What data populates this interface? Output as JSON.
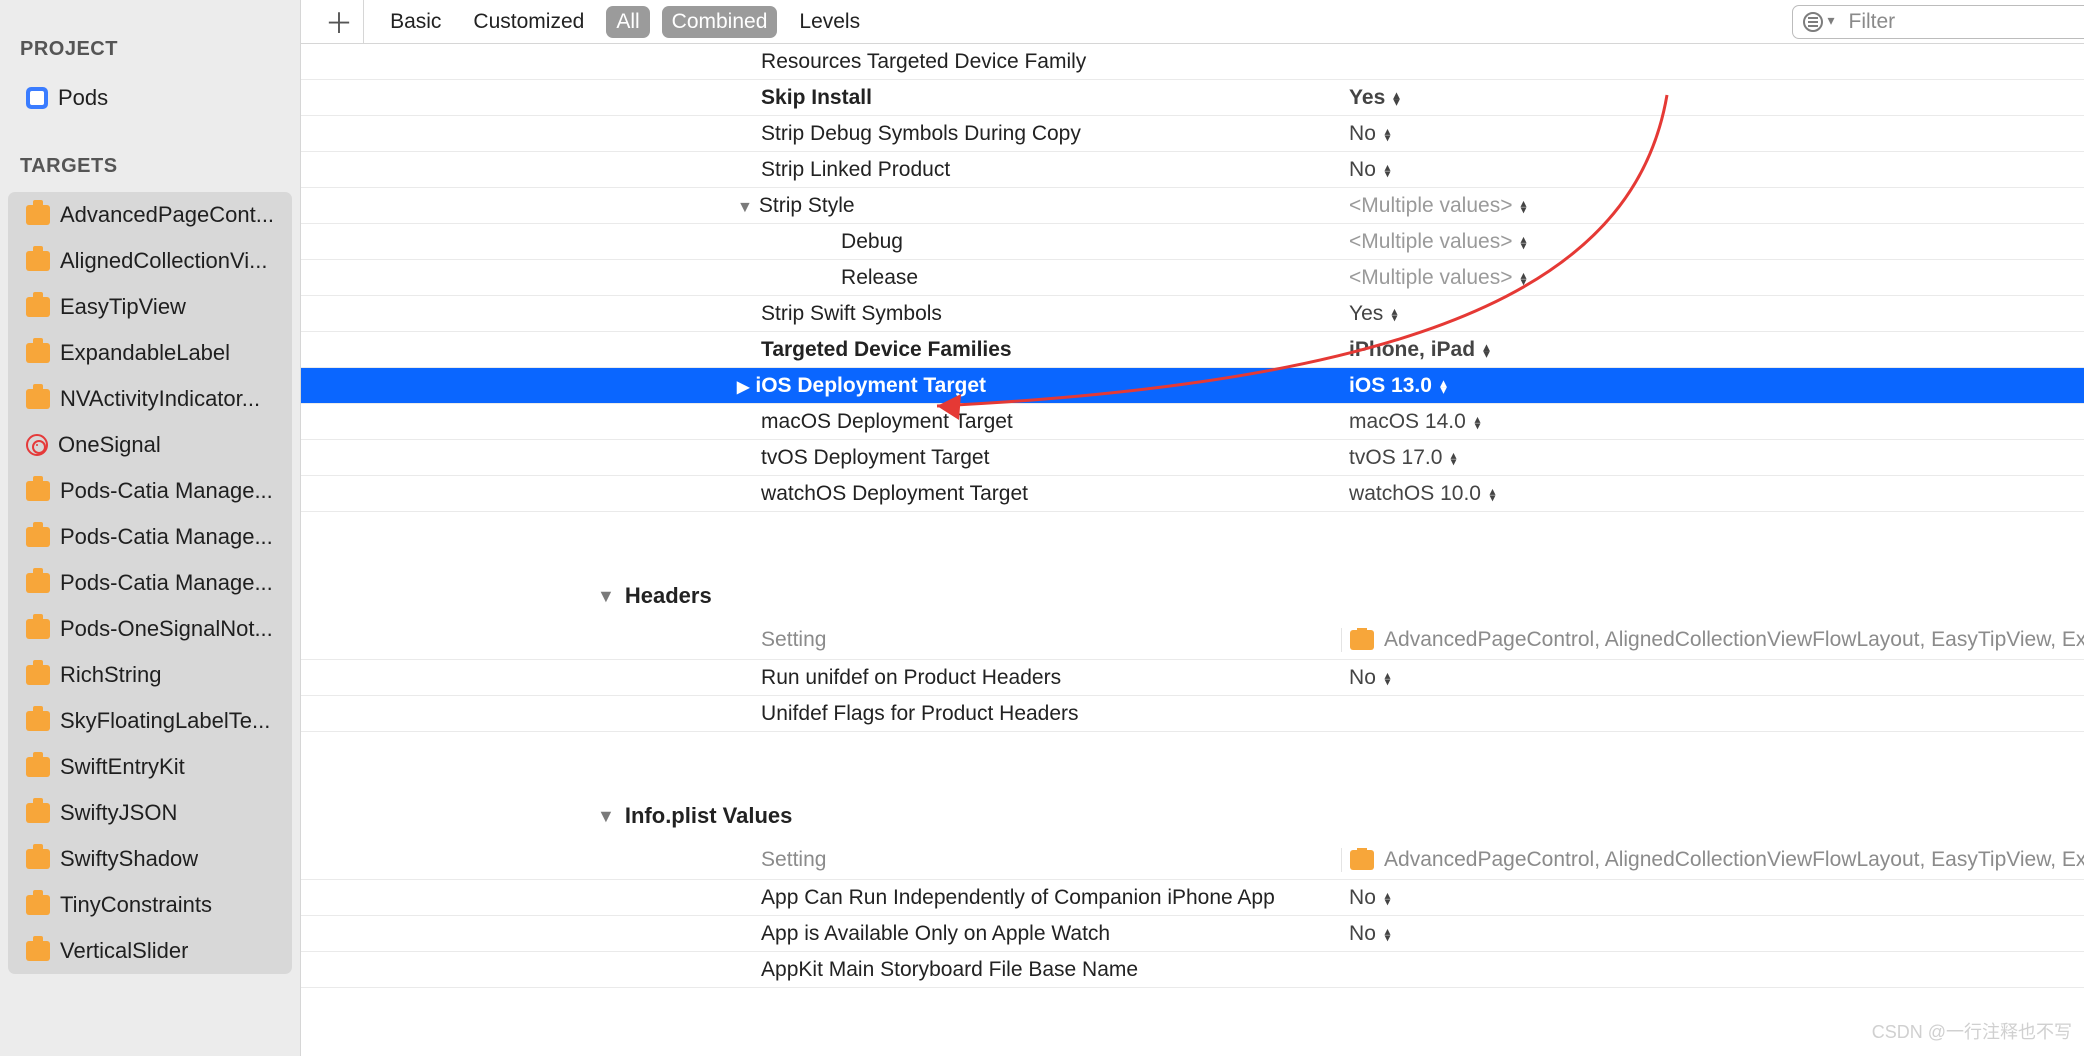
{
  "sidebar": {
    "project_label": "PROJECT",
    "project_name": "Pods",
    "targets_label": "TARGETS",
    "targets": [
      {
        "label": "AdvancedPageCont...",
        "icon": "tool"
      },
      {
        "label": "AlignedCollectionVi...",
        "icon": "tool"
      },
      {
        "label": "EasyTipView",
        "icon": "tool"
      },
      {
        "label": "ExpandableLabel",
        "icon": "tool"
      },
      {
        "label": "NVActivityIndicator...",
        "icon": "tool"
      },
      {
        "label": "OneSignal",
        "icon": "target"
      },
      {
        "label": "Pods-Catia Manage...",
        "icon": "tool"
      },
      {
        "label": "Pods-Catia Manage...",
        "icon": "tool"
      },
      {
        "label": "Pods-Catia Manage...",
        "icon": "tool"
      },
      {
        "label": "Pods-OneSignalNot...",
        "icon": "tool"
      },
      {
        "label": "RichString",
        "icon": "tool"
      },
      {
        "label": "SkyFloatingLabelTe...",
        "icon": "tool"
      },
      {
        "label": "SwiftEntryKit",
        "icon": "tool"
      },
      {
        "label": "SwiftyJSON",
        "icon": "tool"
      },
      {
        "label": "SwiftyShadow",
        "icon": "tool"
      },
      {
        "label": "TinyConstraints",
        "icon": "tool"
      },
      {
        "label": "VerticalSlider",
        "icon": "tool"
      }
    ]
  },
  "toolbar": {
    "tabs": [
      "Basic",
      "Customized",
      "All",
      "Combined",
      "Levels"
    ],
    "active": [
      2,
      3
    ],
    "filter_placeholder": "Filter"
  },
  "settings_rows": [
    {
      "label": "Resources Targeted Device Family",
      "value": "",
      "bold": false,
      "ind": 0
    },
    {
      "label": "Skip Install",
      "value": "Yes",
      "bold": true,
      "ind": 0,
      "updown": true
    },
    {
      "label": "Strip Debug Symbols During Copy",
      "value": "No",
      "bold": false,
      "ind": 0,
      "updown": true
    },
    {
      "label": "Strip Linked Product",
      "value": "No",
      "bold": false,
      "ind": 0,
      "updown": true
    },
    {
      "label": "Strip Style",
      "value": "<Multiple values>",
      "bold": false,
      "ind": 0,
      "updown": true,
      "mult": true,
      "twisty": "down"
    },
    {
      "label": "Debug",
      "value": "<Multiple values>",
      "bold": false,
      "ind": 1,
      "updown": true,
      "mult": true
    },
    {
      "label": "Release",
      "value": "<Multiple values>",
      "bold": false,
      "ind": 1,
      "updown": true,
      "mult": true
    },
    {
      "label": "Strip Swift Symbols",
      "value": "Yes",
      "bold": false,
      "ind": 0,
      "updown": true
    },
    {
      "label": "Targeted Device Families",
      "value": "iPhone, iPad",
      "bold": true,
      "ind": 0,
      "updown": true
    },
    {
      "label": "iOS Deployment Target",
      "value": "iOS 13.0",
      "bold": true,
      "ind": 0,
      "updown": true,
      "sel": true,
      "twisty": "right"
    },
    {
      "label": "macOS Deployment Target",
      "value": "macOS 14.0",
      "bold": false,
      "ind": 0,
      "updown": true
    },
    {
      "label": "tvOS Deployment Target",
      "value": "tvOS 17.0",
      "bold": false,
      "ind": 0,
      "updown": true
    },
    {
      "label": "watchOS Deployment Target",
      "value": "watchOS 10.0",
      "bold": false,
      "ind": 0,
      "updown": true
    }
  ],
  "headers_section": {
    "title": "Headers",
    "col_label": "Setting",
    "col_val": "AdvancedPageControl, AlignedCollectionViewFlowLayout, EasyTipView, ExpandableLabel, NVAc...",
    "rows": [
      {
        "label": "Run unifdef on Product Headers",
        "value": "No",
        "updown": true
      },
      {
        "label": "Unifdef Flags for Product Headers",
        "value": ""
      }
    ]
  },
  "infoplist_section": {
    "title": "Info.plist Values",
    "col_label": "Setting",
    "col_val": "AdvancedPageControl, AlignedCollectionViewFlowLayout, EasyTipView, ExpandableLabel, NVAc...",
    "rows": [
      {
        "label": "App Can Run Independently of Companion iPhone App",
        "value": "No",
        "updown": true
      },
      {
        "label": "App is Available Only on Apple Watch",
        "value": "No",
        "updown": true
      },
      {
        "label": "AppKit Main Storyboard File Base Name",
        "value": ""
      }
    ]
  },
  "watermark": "CSDN @一行注释也不写"
}
